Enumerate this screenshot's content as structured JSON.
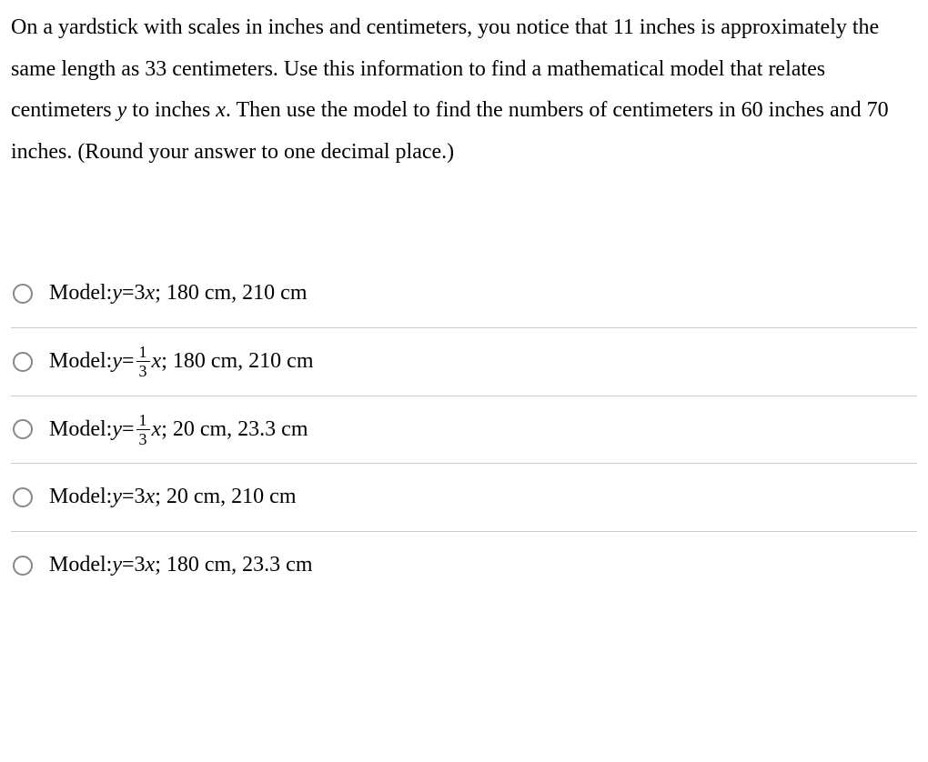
{
  "question": {
    "p1": "On a yardstick with scales in inches and centimeters, you notice that 11 inches is approximately the same length as 33 centimeters. Use this information to find a mathematical model that relates centimeters ",
    "var_y": "y",
    "p2": " to inches ",
    "var_x": "x",
    "p3": ". Then use the model to find the numbers of centimeters in 60 inches and 70 inches. (Round your answer to one decimal place.)"
  },
  "optionLabel": "Model: ",
  "yEq": "y",
  "eq": " = ",
  "options": [
    {
      "type": "plain",
      "coef": "3",
      "xvar": "x",
      "rest": "; 180 cm, 210 cm"
    },
    {
      "type": "frac",
      "num": "1",
      "den": "3",
      "xvar": "x",
      "rest": "; 180 cm, 210 cm"
    },
    {
      "type": "frac",
      "num": "1",
      "den": "3",
      "xvar": "x",
      "rest": "; 20 cm, 23.3 cm"
    },
    {
      "type": "plain",
      "coef": "3",
      "xvar": "x",
      "rest": "; 20 cm, 210 cm"
    },
    {
      "type": "plain",
      "coef": "3",
      "xvar": "x",
      "rest": "; 180 cm, 23.3 cm"
    }
  ]
}
